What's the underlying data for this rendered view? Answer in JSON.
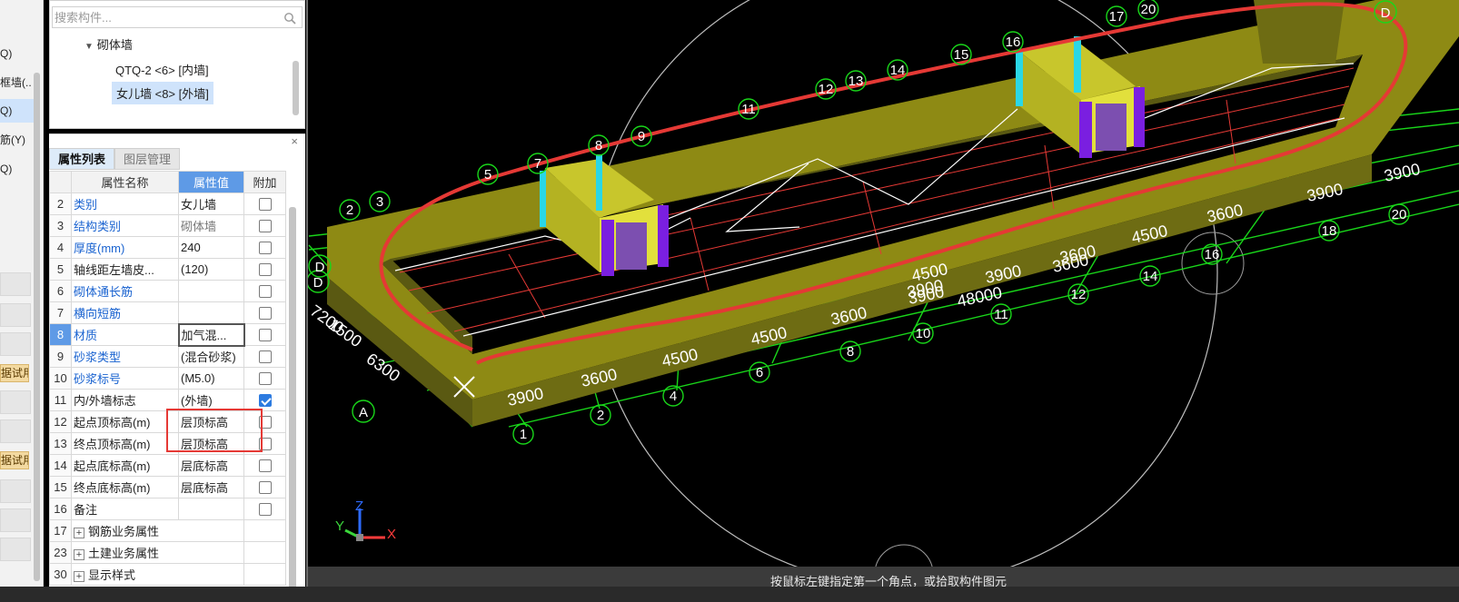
{
  "left_strip": {
    "items": [
      "Q)",
      "框墙(..",
      "Q)",
      "筋(Y)",
      "Q)"
    ],
    "trial_labels": [
      "据试用",
      "据试用"
    ]
  },
  "tree": {
    "search_placeholder": "搜索构件...",
    "group_label": "砌体墙",
    "items": [
      "QTQ-2 <6> [内墙]",
      "女儿墙 <8> [外墙]"
    ]
  },
  "properties": {
    "close_symbol": "×",
    "tabs": [
      "属性列表",
      "图层管理"
    ],
    "headers": [
      "属性名称",
      "属性值",
      "附加"
    ],
    "rows": [
      {
        "num": "2",
        "name": "类别",
        "value": "女儿墙",
        "checked": false
      },
      {
        "num": "3",
        "name": "结构类别",
        "value": "砌体墙",
        "checked": false
      },
      {
        "num": "4",
        "name": "厚度(mm)",
        "value": "240",
        "checked": false
      },
      {
        "num": "5",
        "name": "轴线距左墙皮...",
        "value": "(120)",
        "checked": false
      },
      {
        "num": "6",
        "name": "砌体通长筋",
        "value": "",
        "checked": false
      },
      {
        "num": "7",
        "name": "横向短筋",
        "value": "",
        "checked": false
      },
      {
        "num": "8",
        "name": "材质",
        "value": "加气混...",
        "checked": false
      },
      {
        "num": "9",
        "name": "砂浆类型",
        "value": "(混合砂浆)",
        "checked": false
      },
      {
        "num": "10",
        "name": "砂浆标号",
        "value": "(M5.0)",
        "checked": false
      },
      {
        "num": "11",
        "name": "内/外墙标志",
        "value": "(外墙)",
        "checked": true
      },
      {
        "num": "12",
        "name": "起点顶标高(m)",
        "value": "层顶标高",
        "checked": false
      },
      {
        "num": "13",
        "name": "终点顶标高(m)",
        "value": "层顶标高",
        "checked": false
      },
      {
        "num": "14",
        "name": "起点底标高(m)",
        "value": "层底标高",
        "checked": false
      },
      {
        "num": "15",
        "name": "终点底标高(m)",
        "value": "层底标高",
        "checked": false
      },
      {
        "num": "16",
        "name": "备注",
        "value": "",
        "checked": false
      }
    ],
    "groups": [
      {
        "num": "17",
        "name": "钢筋业务属性"
      },
      {
        "num": "23",
        "name": "土建业务属性"
      },
      {
        "num": "30",
        "name": "显示样式"
      }
    ]
  },
  "viewport": {
    "axis_numbers": [
      "1",
      "2",
      "3",
      "4",
      "5",
      "6",
      "7",
      "8",
      "9",
      "10",
      "11",
      "12",
      "13",
      "14",
      "15",
      "16",
      "17",
      "18",
      "20",
      "20",
      "12",
      "13",
      "14",
      "15",
      "16",
      "2",
      "3",
      "5",
      "7",
      "8",
      "9",
      "11",
      "12"
    ],
    "axis_letters": [
      "A",
      "D",
      "D",
      "D"
    ],
    "dimensions": [
      "3900",
      "3600",
      "4500",
      "4500",
      "3600",
      "3900",
      "48000",
      "3900",
      "3600",
      "4500",
      "3600",
      "3900",
      "6300",
      "1500",
      "7200",
      "3900",
      "4500",
      "3600",
      "3900"
    ],
    "gizmo_labels": {
      "x": "X",
      "y": "Y",
      "z": "Z"
    },
    "status_text": "按鼠标左键指定第一个角点，或拾取构件图元"
  },
  "colors": {
    "wall_top": "#8e8a14",
    "wall_side": "#5a5912",
    "grid_green": "#19d61a",
    "annotation_red": "#e53935",
    "accent_blue": "#5e9ae6",
    "column_purple": "#7a1fe0",
    "column_cyan": "#2ad7e6"
  }
}
